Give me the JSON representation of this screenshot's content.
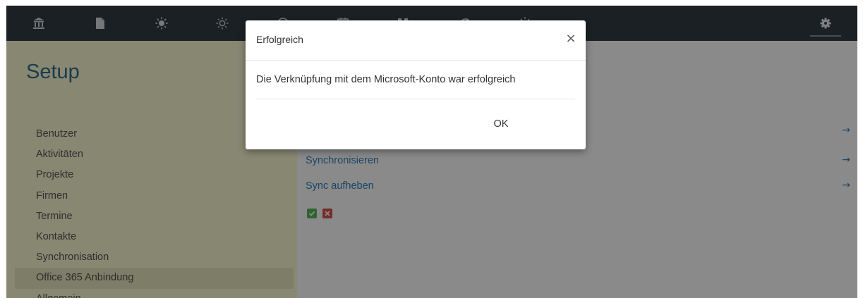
{
  "colors": {
    "topbar_bg": "#333b43",
    "sidebar_bg": "#fbf9d2",
    "sidebar_active_bg": "#e9e7bf",
    "title_color": "#2f6f8e",
    "link_color": "#2f80b9",
    "ok_status": "#5cb85c",
    "error_status": "#d9534f"
  },
  "topbar": {
    "icons": [
      "bank-icon",
      "document-icon",
      "sun-filled-icon",
      "sun-outline-icon",
      "circle-icon",
      "calendar-icon",
      "grid-icon",
      "refresh-icon",
      "sun-icon",
      "gear-icon"
    ]
  },
  "sidebar": {
    "title": "Setup",
    "items": [
      {
        "label": "Benutzer"
      },
      {
        "label": "Aktivitäten"
      },
      {
        "label": "Projekte"
      },
      {
        "label": "Firmen"
      },
      {
        "label": "Termine"
      },
      {
        "label": "Kontakte"
      },
      {
        "label": "Synchronisation"
      },
      {
        "label": "Office 365 Anbindung",
        "active": true
      },
      {
        "label": "Allgemein"
      }
    ]
  },
  "content": {
    "links": [
      {
        "label": ""
      },
      {
        "label": "Synchronisieren"
      },
      {
        "label": "Sync aufheben"
      }
    ],
    "arrow_glyph": "→",
    "status_icons": [
      "check-icon",
      "cross-icon"
    ]
  },
  "modal": {
    "title": "Erfolgreich",
    "close_glyph": "×",
    "message": "Die Verknüpfung mit dem Microsoft-Konto war erfolgreich",
    "ok_label": "OK"
  }
}
